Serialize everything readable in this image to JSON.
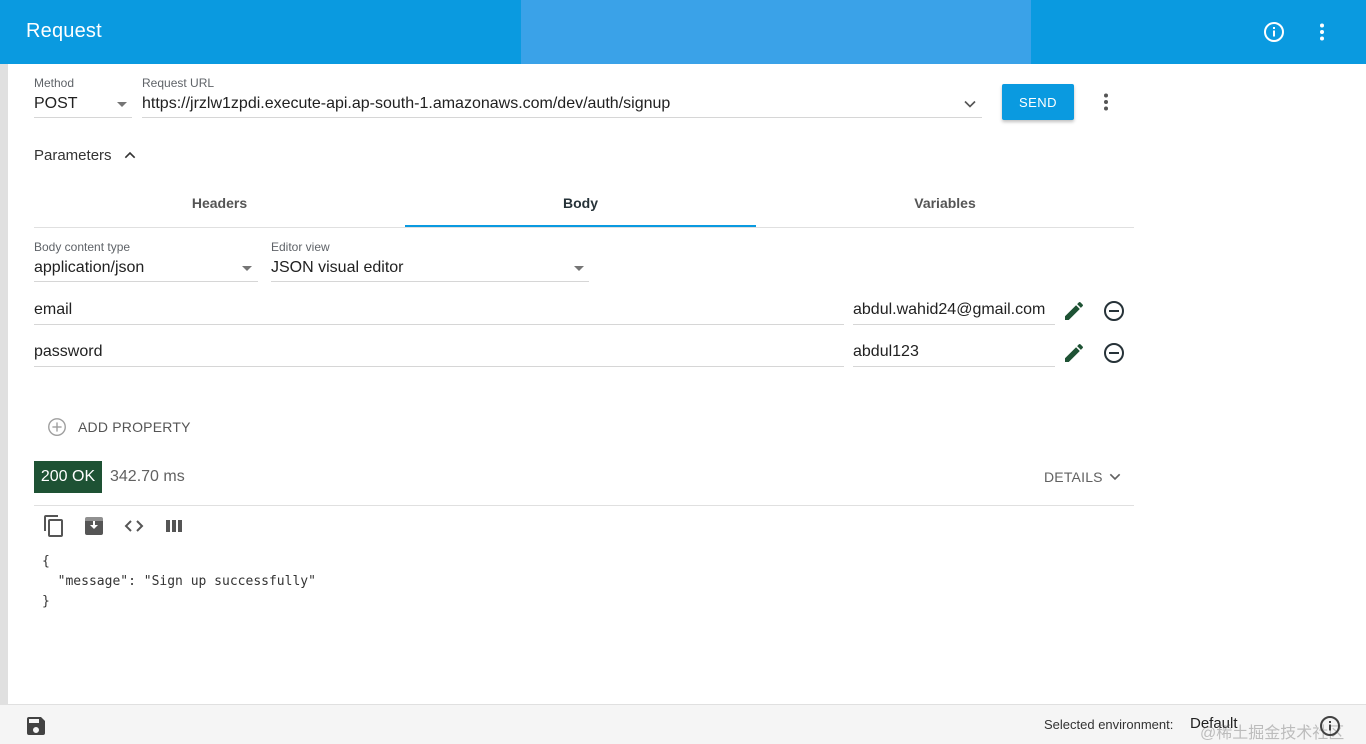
{
  "header": {
    "title": "Request",
    "icons": {
      "info": "info-icon",
      "more": "more-vert-icon"
    }
  },
  "request": {
    "method_label": "Method",
    "method_value": "POST",
    "url_label": "Request URL",
    "url_value": "https://jrzlw1zpdi.execute-api.ap-south-1.amazonaws.com/dev/auth/signup",
    "send_label": "SEND"
  },
  "parameters": {
    "title": "Parameters",
    "tabs": [
      {
        "label": "Headers",
        "active": false
      },
      {
        "label": "Body",
        "active": true
      },
      {
        "label": "Variables",
        "active": false
      }
    ]
  },
  "body": {
    "content_type_label": "Body content type",
    "content_type_value": "application/json",
    "editor_view_label": "Editor view",
    "editor_view_value": "JSON visual editor",
    "properties": [
      {
        "name": "email",
        "value": "abdul.wahid24@gmail.com"
      },
      {
        "name": "password",
        "value": "abdul123"
      }
    ],
    "add_property_label": "ADD PROPERTY"
  },
  "response": {
    "status": "200 OK",
    "time": "342.70 ms",
    "details_label": "DETAILS",
    "code_lines": [
      "{",
      "  \"message\": \"Sign up successfully\"",
      "}"
    ]
  },
  "footer": {
    "env_label": "Selected environment:",
    "env_value": "Default",
    "watermark": "@稀土掘金技术社区"
  },
  "colors": {
    "primary": "#0a9ae0",
    "status_ok": "#1e5234",
    "icon_dark": "#1e5234"
  }
}
